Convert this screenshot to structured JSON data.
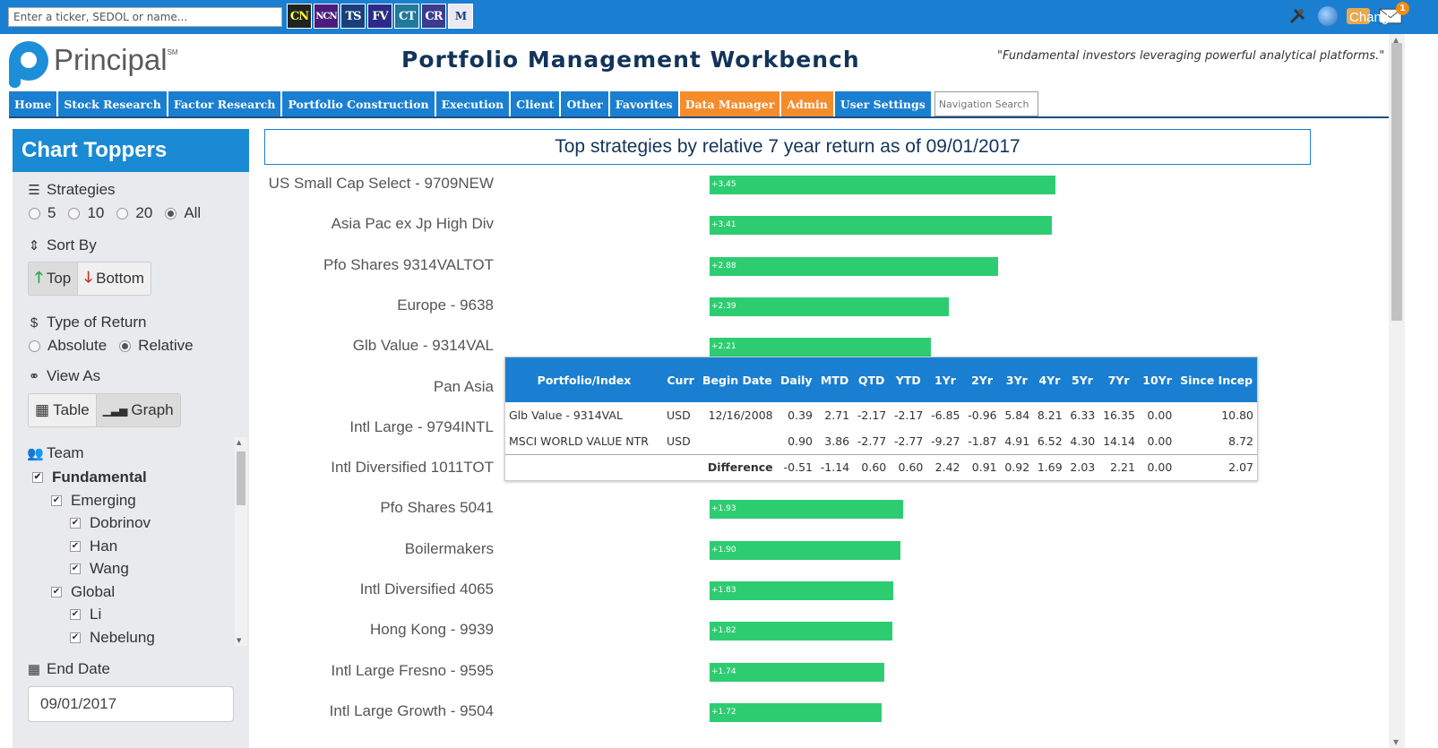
{
  "topbar": {
    "ticker_placeholder": "Enter a ticker, SEDOL or name...",
    "tools": [
      {
        "icon": "cn-icon",
        "text": "CN"
      },
      {
        "icon": "ncn-icon",
        "text": "NCN"
      },
      {
        "icon": "ts-icon",
        "text": "TS"
      },
      {
        "icon": "fv-icon",
        "text": "FV"
      },
      {
        "icon": "ct-icon",
        "text": "CT"
      },
      {
        "icon": "cr-icon",
        "text": "CR"
      },
      {
        "icon": "m-icon",
        "text": "M"
      }
    ],
    "notification_count": "1",
    "username": "Chang"
  },
  "header": {
    "logo": "Principal",
    "logo_mark": "SM",
    "title": "Portfolio Management Workbench",
    "tagline": "\"Fundamental investors leveraging powerful analytical platforms.\""
  },
  "nav": {
    "items": [
      {
        "label": "Home",
        "style": "blue"
      },
      {
        "label": "Stock Research",
        "style": "blue"
      },
      {
        "label": "Factor Research",
        "style": "blue"
      },
      {
        "label": "Portfolio Construction",
        "style": "blue"
      },
      {
        "label": "Execution",
        "style": "blue"
      },
      {
        "label": "Client",
        "style": "blue"
      },
      {
        "label": "Other",
        "style": "blue"
      },
      {
        "label": "Favorites",
        "style": "blue"
      },
      {
        "label": "Data Manager",
        "style": "orange"
      },
      {
        "label": "Admin",
        "style": "orange"
      },
      {
        "label": "User Settings",
        "style": "blue"
      }
    ],
    "search_placeholder": "Navigation Search"
  },
  "sidebar": {
    "title": "Chart Toppers",
    "strategies_label": "Strategies",
    "strategies_options": [
      "5",
      "10",
      "20",
      "All"
    ],
    "strategies_selected": "All",
    "sort_label": "Sort By",
    "sort_top": "Top",
    "sort_bottom": "Bottom",
    "return_label": "Type of Return",
    "return_options": [
      "Absolute",
      "Relative"
    ],
    "return_selected": "Relative",
    "view_label": "View As",
    "view_table": "Table",
    "view_graph": "Graph",
    "team_label": "Team",
    "team": [
      {
        "label": "Fundamental",
        "level": 0,
        "bold": true
      },
      {
        "label": "Emerging",
        "level": 1,
        "bold": false
      },
      {
        "label": "Dobrinov",
        "level": 2,
        "bold": false
      },
      {
        "label": "Han",
        "level": 2,
        "bold": false
      },
      {
        "label": "Wang",
        "level": 2,
        "bold": false
      },
      {
        "label": "Global",
        "level": 1,
        "bold": false
      },
      {
        "label": "Li",
        "level": 2,
        "bold": false
      },
      {
        "label": "Nebelung",
        "level": 2,
        "bold": false
      }
    ],
    "end_date_label": "End Date",
    "end_date": "09/01/2017"
  },
  "main": {
    "title": "Top strategies by relative 7 year return as of 09/01/2017"
  },
  "chart_data": {
    "type": "bar",
    "orientation": "horizontal",
    "title": "Top strategies by relative 7 year return as of 09/01/2017",
    "categories": [
      "US Small Cap Select - 9709NEW",
      "Asia Pac ex Jp High Div",
      "Pfo Shares 9314VALTOT",
      "Europe - 9638",
      "Glb Value - 9314VAL",
      "Pan Asia",
      "Intl Large - 9794INTL",
      "Intl Diversified 1011TOT",
      "Pfo Shares 5041",
      "Boilermakers",
      "Intl Diversified 4065",
      "Hong Kong - 9939",
      "Intl Large Fresno - 9595",
      "Intl Large Growth - 9504"
    ],
    "values": [
      3.45,
      3.41,
      2.88,
      2.39,
      2.21,
      null,
      null,
      null,
      1.93,
      1.9,
      1.83,
      1.82,
      1.74,
      1.72
    ],
    "labels": [
      "+3.45",
      "+3.41",
      "+2.88",
      "+2.39",
      "+2.21",
      "",
      "",
      "",
      "+1.93",
      "+1.90",
      "+1.83",
      "+1.82",
      "+1.74",
      "+1.72"
    ],
    "bar_color": "#2ecc71",
    "xlim": [
      0,
      3.45
    ]
  },
  "popup": {
    "headers": [
      "Portfolio/Index",
      "Curr",
      "Begin Date",
      "Daily",
      "MTD",
      "QTD",
      "YTD",
      "1Yr",
      "2Yr",
      "3Yr",
      "4Yr",
      "5Yr",
      "7Yr",
      "10Yr",
      "Since Incep"
    ],
    "rows": [
      [
        "Glb Value - 9314VAL",
        "USD",
        "12/16/2008",
        "0.39",
        "2.71",
        "-2.17",
        "-2.17",
        "-6.85",
        "-0.96",
        "5.84",
        "8.21",
        "6.33",
        "16.35",
        "0.00",
        "10.80"
      ],
      [
        "MSCI WORLD VALUE NTR",
        "USD",
        "",
        "0.90",
        "3.86",
        "-2.77",
        "-2.77",
        "-9.27",
        "-1.87",
        "4.91",
        "6.52",
        "4.30",
        "14.14",
        "0.00",
        "8.72"
      ],
      [
        "",
        "",
        "Difference",
        "-0.51",
        "-1.14",
        "0.60",
        "0.60",
        "2.42",
        "0.91",
        "0.92",
        "1.69",
        "2.03",
        "2.21",
        "0.00",
        "2.07"
      ]
    ]
  }
}
